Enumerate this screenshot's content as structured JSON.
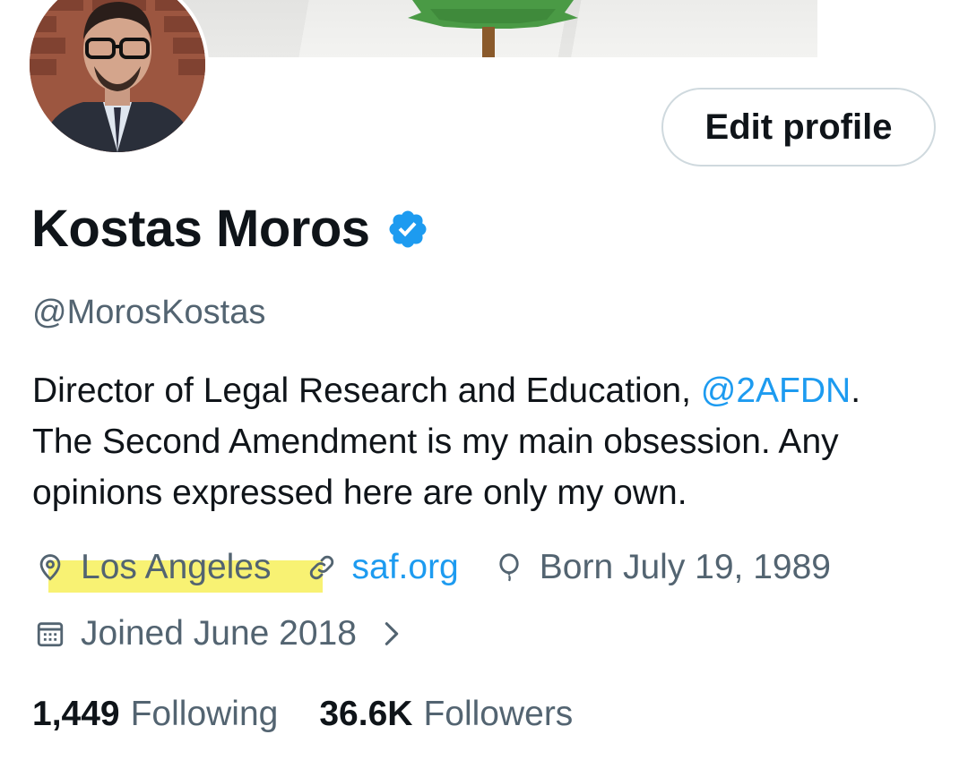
{
  "profile": {
    "name": "Kostas Moros",
    "handle": "@MorosKostas",
    "edit_label": "Edit profile",
    "bio_line1_prefix": "Director of Legal Research and Education, ",
    "bio_mention": "@2AFDN",
    "bio_line1_suffix": ".",
    "bio_line2": "The Second Amendment is my main obsession. Any",
    "bio_line3": "opinions expressed here are only my own.",
    "location": "Los Angeles",
    "website": "saf.org",
    "birthday": "Born July 19, 1989",
    "joined": "Joined June 2018",
    "following_count": "1,449",
    "following_label": "Following",
    "followers_count": "36.6K",
    "followers_label": "Followers"
  },
  "icons": {
    "verified": "verified-badge-icon",
    "location": "location-pin-icon",
    "link": "link-icon",
    "birthday": "balloon-icon",
    "joined": "calendar-icon",
    "chevron": "chevron-right-icon"
  },
  "colors": {
    "accent": "#1d9bf0",
    "secondary_text": "#536471",
    "primary_text": "#0f1419",
    "highlight": "#f7f05a"
  }
}
